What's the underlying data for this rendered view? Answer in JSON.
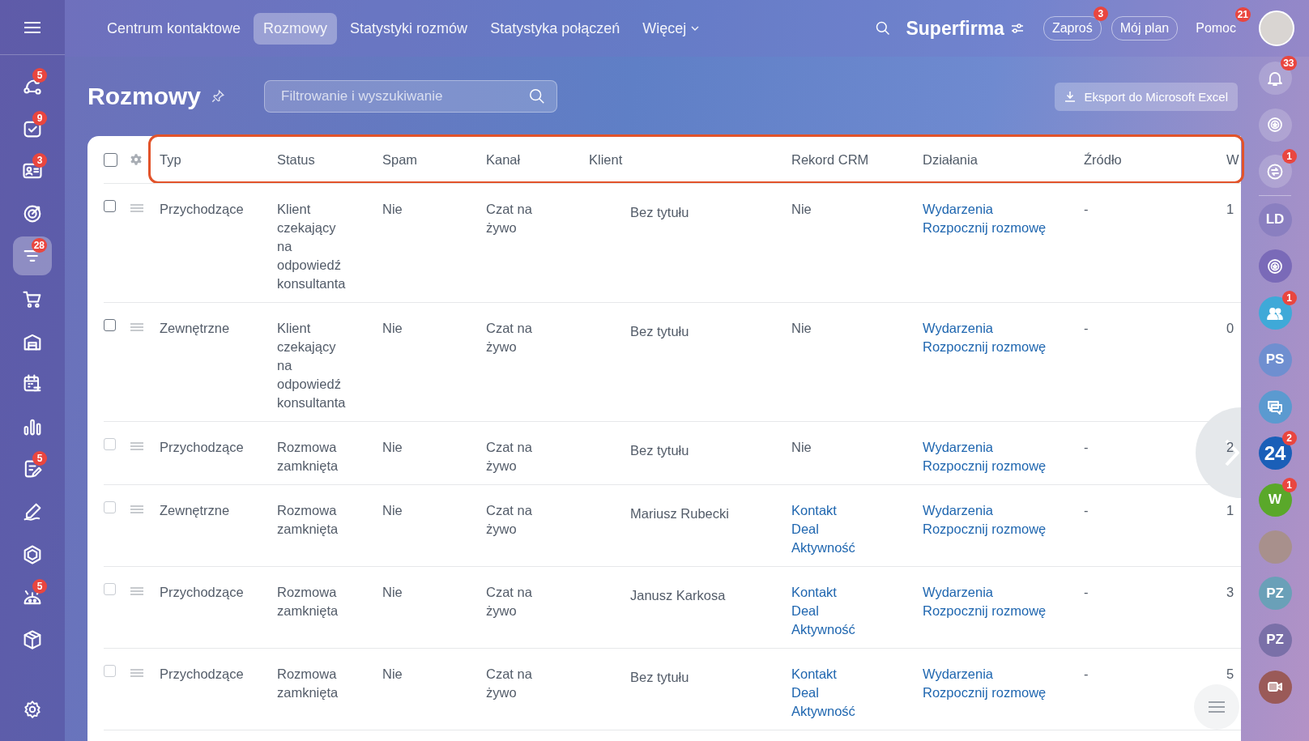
{
  "left_sidebar": {
    "items": [
      {
        "kind": "pipeline",
        "badge": "5",
        "selected": false
      },
      {
        "kind": "tasks",
        "badge": "9",
        "selected": false
      },
      {
        "kind": "contact",
        "badge": "3",
        "selected": false
      },
      {
        "kind": "target",
        "selected": false
      },
      {
        "kind": "funnel",
        "badge": "28",
        "selected": true
      },
      {
        "kind": "cart",
        "selected": false
      },
      {
        "kind": "warehouse",
        "selected": false
      },
      {
        "kind": "calendar",
        "selected": false
      },
      {
        "kind": "chart",
        "selected": false
      },
      {
        "kind": "document",
        "badge": "5",
        "selected": false
      },
      {
        "kind": "pen",
        "selected": false
      },
      {
        "kind": "hexagon",
        "selected": false
      },
      {
        "kind": "robot",
        "badge": "5",
        "selected": false
      },
      {
        "kind": "cube",
        "selected": false
      }
    ]
  },
  "top_bar": {
    "tabs": [
      {
        "label": "Centrum kontaktowe",
        "selected": false
      },
      {
        "label": "Rozmowy",
        "selected": true
      },
      {
        "label": "Statystyki rozmów",
        "selected": false
      },
      {
        "label": "Statystyka połączeń",
        "selected": false
      },
      {
        "label": "Więcej",
        "selected": false,
        "dropdown": true
      }
    ],
    "company": "Superfirma",
    "buttons": [
      {
        "label": "Zaproś",
        "badge": "3",
        "outlined": true
      },
      {
        "label": "Mój plan",
        "outlined": true
      },
      {
        "label": "Pomoc",
        "badge": "21",
        "outlined": false
      }
    ]
  },
  "page": {
    "title": "Rozmowy",
    "search": {
      "placeholder": "Filtrowanie i wyszukiwanie"
    },
    "export_button": "Eksport do Microsoft Excel"
  },
  "table": {
    "header_highlighted": true,
    "all_selected": false,
    "columns": [
      "Typ",
      "Status",
      "Spam",
      "Kanał",
      "Klient",
      "Rekord CRM",
      "Działania",
      "Źródło",
      "W"
    ],
    "rows": [
      {
        "selected": false,
        "disabled": false,
        "typ": "Przychodzące",
        "status": "Klient czekający na odpowiedź konsultanta",
        "spam": "Nie",
        "kanal": "Czat na żywo",
        "klient": "Bez tytułu",
        "rekord_crm": [
          {
            "kind": "text",
            "text": "Nie"
          }
        ],
        "dzialania": [
          "Wydarzenia",
          "Rozpocznij rozmowę"
        ],
        "zrodlo": "-",
        "column_w": "1"
      },
      {
        "selected": false,
        "disabled": false,
        "typ": "Zewnętrzne",
        "status": "Klient czekający na odpowiedź konsultanta",
        "spam": "Nie",
        "kanal": "Czat na żywo",
        "klient": "Bez tytułu",
        "rekord_crm": [
          {
            "kind": "text",
            "text": "Nie"
          }
        ],
        "dzialania": [
          "Wydarzenia",
          "Rozpocznij rozmowę"
        ],
        "zrodlo": "-",
        "column_w": "0"
      },
      {
        "selected": false,
        "disabled": true,
        "typ": "Przychodzące",
        "status": "Rozmowa zamknięta",
        "spam": "Nie",
        "kanal": "Czat na żywo",
        "klient": "Bez tytułu",
        "rekord_crm": [
          {
            "kind": "text",
            "text": "Nie"
          }
        ],
        "dzialania": [
          "Wydarzenia",
          "Rozpocznij rozmowę"
        ],
        "zrodlo": "-",
        "column_w": "2"
      },
      {
        "selected": false,
        "disabled": true,
        "typ": "Zewnętrzne",
        "status": "Rozmowa zamknięta",
        "spam": "Nie",
        "kanal": "Czat na żywo",
        "klient": "Mariusz Rubecki",
        "rekord_crm": [
          {
            "kind": "link",
            "text": "Kontakt"
          },
          {
            "kind": "link",
            "text": "Deal"
          },
          {
            "kind": "link",
            "text": "Aktywność"
          }
        ],
        "dzialania": [
          "Wydarzenia",
          "Rozpocznij rozmowę"
        ],
        "zrodlo": "-",
        "column_w": "1"
      },
      {
        "selected": false,
        "disabled": true,
        "typ": "Przychodzące",
        "status": "Rozmowa zamknięta",
        "spam": "Nie",
        "kanal": "Czat na żywo",
        "klient": "Janusz Karkosa",
        "rekord_crm": [
          {
            "kind": "link",
            "text": "Kontakt"
          },
          {
            "kind": "link",
            "text": "Deal"
          },
          {
            "kind": "link",
            "text": "Aktywność"
          }
        ],
        "dzialania": [
          "Wydarzenia",
          "Rozpocznij rozmowę"
        ],
        "zrodlo": "-",
        "column_w": "3"
      },
      {
        "selected": false,
        "disabled": true,
        "typ": "Przychodzące",
        "status": "Rozmowa zamknięta",
        "spam": "Nie",
        "kanal": "Czat na żywo",
        "klient": "Bez tytułu",
        "rekord_crm": [
          {
            "kind": "link",
            "text": "Kontakt"
          },
          {
            "kind": "link",
            "text": "Deal"
          },
          {
            "kind": "link",
            "text": "Aktywność"
          }
        ],
        "dzialania": [
          "Wydarzenia",
          "Rozpocznij rozmowę"
        ],
        "zrodlo": "-",
        "column_w": "5"
      }
    ]
  },
  "right_sidebar": {
    "items": [
      {
        "kind": "bell",
        "badge": "33"
      },
      {
        "kind": "ring"
      },
      {
        "kind": "swap",
        "badge": "1"
      },
      {
        "kind": "divider"
      },
      {
        "kind": "initials",
        "text": "LD",
        "color": "#8a7fc0"
      },
      {
        "kind": "ring",
        "color": "#7a6ab8"
      },
      {
        "kind": "people",
        "badge": "1",
        "color": "#3fa9d8"
      },
      {
        "kind": "initials",
        "text": "PS",
        "color": "#6f8fd0"
      },
      {
        "kind": "chat",
        "color": "#5b9ad0"
      },
      {
        "kind": "initials",
        "text": "24",
        "badge": "2",
        "color": "#1a5fb8"
      },
      {
        "kind": "initials",
        "text": "W",
        "badge": "1",
        "color": "#5aa82a"
      },
      {
        "kind": "photo",
        "color": "#a8908c"
      },
      {
        "kind": "initials",
        "text": "PZ",
        "color": "#6aa0b8"
      },
      {
        "kind": "initials",
        "text": "PZ",
        "color": "#7a70a8"
      },
      {
        "kind": "video",
        "color": "#9a5a58"
      }
    ]
  }
}
